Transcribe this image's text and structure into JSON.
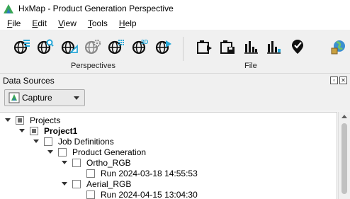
{
  "window": {
    "title": "HxMap - Product Generation Perspective"
  },
  "menu": {
    "items": [
      {
        "label": "File",
        "accel": "F",
        "rest": "ile"
      },
      {
        "label": "Edit",
        "accel": "E",
        "rest": "dit"
      },
      {
        "label": "View",
        "accel": "V",
        "rest": "iew"
      },
      {
        "label": "Tools",
        "accel": "T",
        "rest": "ools"
      },
      {
        "label": "Help",
        "accel": "H",
        "rest": "elp"
      }
    ]
  },
  "toolbar": {
    "perspectives_label": "Perspectives",
    "file_label": "File",
    "perspective_buttons": [
      {
        "icon": "globe-list-icon"
      },
      {
        "icon": "globe-search-icon"
      },
      {
        "icon": "globe-triangle-icon"
      },
      {
        "icon": "globe-gear-icon"
      },
      {
        "icon": "globe-grid-icon"
      },
      {
        "icon": "globe-3d-icon"
      },
      {
        "icon": "globe-play-icon"
      }
    ],
    "file_buttons": [
      {
        "icon": "play-export-icon"
      },
      {
        "icon": "save-disk-icon"
      },
      {
        "icon": "bar-chart-icon"
      },
      {
        "icon": "bar-chart-lock-icon"
      },
      {
        "icon": "location-check-icon"
      }
    ],
    "extra_button": {
      "icon": "globe-network-icon"
    },
    "three_d_text": "3D"
  },
  "data_sources": {
    "title": "Data Sources",
    "restore_btn": "▫",
    "close_btn": "✕",
    "capture_value": "Capture"
  },
  "tree": {
    "rows": [
      {
        "label": "Projects",
        "bold": false,
        "state": "partial"
      },
      {
        "label": "Project1",
        "bold": true,
        "state": "partial"
      },
      {
        "label": "Job Definitions",
        "bold": false,
        "state": "empty"
      },
      {
        "label": "Product Generation",
        "bold": false,
        "state": "empty"
      },
      {
        "label": "Ortho_RGB",
        "bold": false,
        "state": "empty"
      },
      {
        "label": "Run 2024-03-18 14:55:53",
        "bold": false,
        "state": "empty"
      },
      {
        "label": "Aerial_RGB",
        "bold": false,
        "state": "empty"
      },
      {
        "label": "Run 2024-04-15 13:04:30",
        "bold": false,
        "state": "empty"
      }
    ]
  },
  "colors": {
    "accent_cyan": "#29a8d8",
    "accent_dark": "#111111",
    "logo_green": "#3aa655"
  }
}
